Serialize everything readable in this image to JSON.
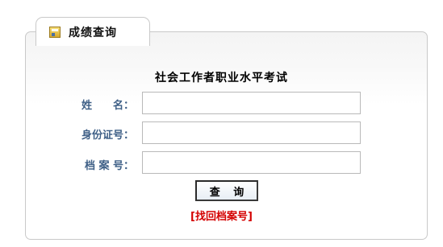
{
  "tab": {
    "title": "成绩查询",
    "icon": "id-card-icon"
  },
  "form": {
    "exam_title": "社会工作者职业水平考试",
    "fields": [
      {
        "label": "姓　　名：",
        "value": ""
      },
      {
        "label": "身份证号：",
        "value": ""
      },
      {
        "label": "档 案 号：",
        "value": ""
      }
    ],
    "query_label": "查 询",
    "recover_link": "[找回档案号]"
  },
  "colors": {
    "label": "#3e5f86",
    "link": "#d40000",
    "border": "#c9c9c9"
  }
}
